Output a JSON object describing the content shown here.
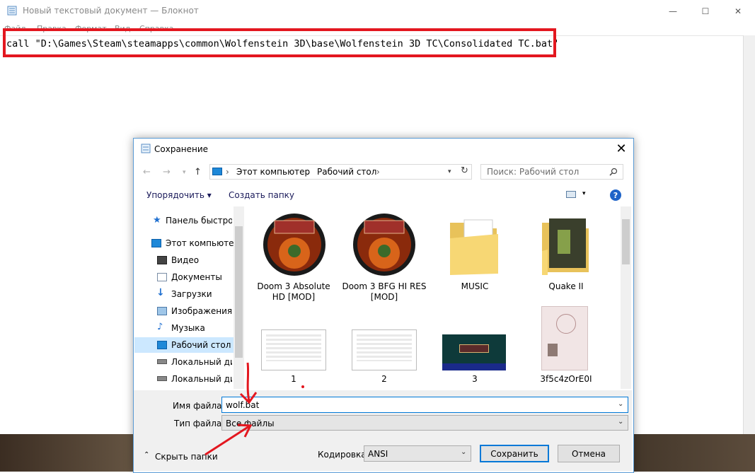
{
  "notepad": {
    "title": "Новый текстовый документ — Блокнот",
    "menu": [
      "Файл",
      "Правка",
      "Формат",
      "Вид",
      "Справка"
    ],
    "content": "call \"D:\\Games\\Steam\\steamapps\\common\\Wolfenstein 3D\\base\\Wolfenstein 3D TC\\Consolidated TC.bat\""
  },
  "window_controls": {
    "minimize": "—",
    "maximize": "☐",
    "close": "✕"
  },
  "dialog": {
    "title": "Сохранение",
    "close": "✕",
    "breadcrumb": [
      "Этот компьютер",
      "Рабочий стол"
    ],
    "search_placeholder": "Поиск: Рабочий стол",
    "toolbar": {
      "organize": "Упорядочить ▾",
      "new_folder": "Создать папку",
      "help": "?"
    },
    "nav_items": [
      {
        "label": "Панель быстрого доступа",
        "icon": "star-icon"
      },
      {
        "label": "Этот компьютер",
        "icon": "computer-icon"
      },
      {
        "label": "Видео",
        "icon": "video-icon"
      },
      {
        "label": "Документы",
        "icon": "documents-icon"
      },
      {
        "label": "Загрузки",
        "icon": "download-icon"
      },
      {
        "label": "Изображения",
        "icon": "pictures-icon"
      },
      {
        "label": "Музыка",
        "icon": "music-icon"
      },
      {
        "label": "Рабочий стол",
        "icon": "desktop-icon"
      },
      {
        "label": "Локальный диск",
        "icon": "drive-icon"
      },
      {
        "label": "Локальный диск",
        "icon": "drive-icon"
      }
    ],
    "files": [
      {
        "label": "Doom 3 Absolute HD [MOD]",
        "icon": "doom-icon"
      },
      {
        "label": "Doom 3 BFG HI RES [MOD]",
        "icon": "doom-icon"
      },
      {
        "label": "MUSIC",
        "icon": "folder-icon"
      },
      {
        "label": "Quake II",
        "icon": "folder-icon"
      },
      {
        "label": "1",
        "icon": "screenshot-thumbnail"
      },
      {
        "label": "2",
        "icon": "screenshot-thumbnail"
      },
      {
        "label": "3",
        "icon": "game-screenshot-thumbnail"
      },
      {
        "label": "3f5c4zOrE0I",
        "icon": "passport-photo-thumbnail"
      }
    ],
    "filename_label": "Имя файла:",
    "filename_value": "wolf.bat",
    "filetype_label": "Тип файла:",
    "filetype_value": "Все файлы",
    "hide_folders": "Скрыть папки",
    "encoding_label": "Кодировка:",
    "encoding_value": "ANSI",
    "save": "Сохранить",
    "cancel": "Отмена"
  },
  "colors": {
    "highlight_box": "#e3171f",
    "accent": "#0078d7",
    "selection": "#cce8ff"
  }
}
